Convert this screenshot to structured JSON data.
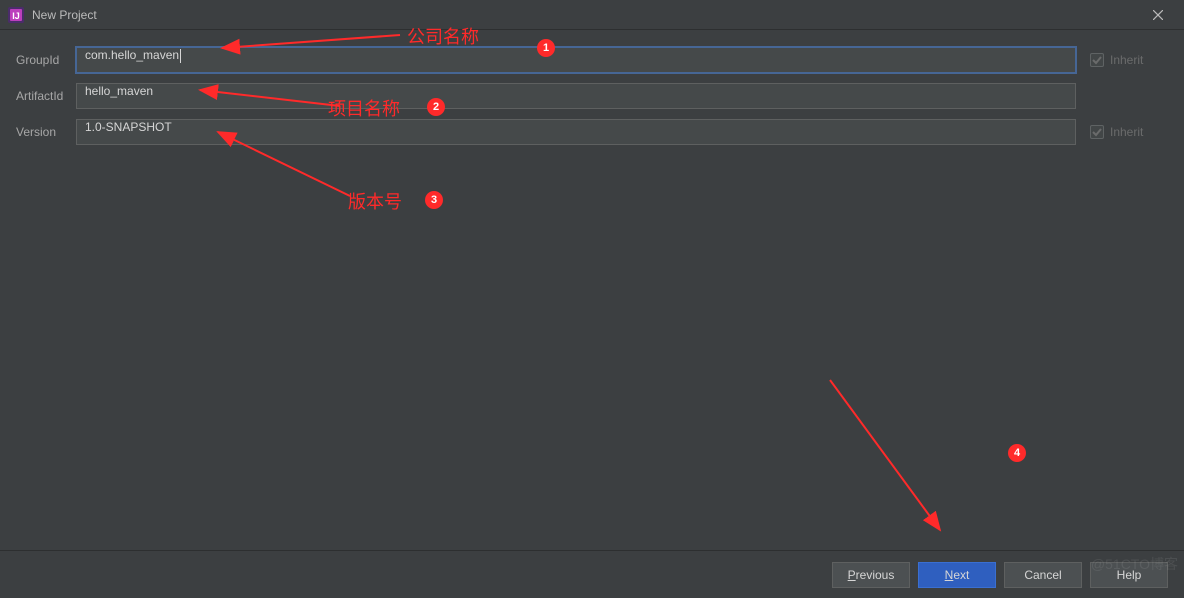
{
  "titlebar": {
    "title": "New Project"
  },
  "form": {
    "groupId": {
      "label": "GroupId",
      "value": "com.hello_maven",
      "inheritLabel": "Inherit",
      "inheritChecked": true,
      "focused": true
    },
    "artifactId": {
      "label": "ArtifactId",
      "value": "hello_maven"
    },
    "version": {
      "label": "Version",
      "value": "1.0-SNAPSHOT",
      "inheritLabel": "Inherit",
      "inheritChecked": true
    }
  },
  "footer": {
    "previousUL": "P",
    "previousRest": "revious",
    "nextUL": "N",
    "nextRest": "ext",
    "cancel": "Cancel",
    "help": "Help"
  },
  "annotations": [
    {
      "num": "1",
      "text": "公司名称"
    },
    {
      "num": "2",
      "text": "项目名称"
    },
    {
      "num": "3",
      "text": "版本号"
    },
    {
      "num": "4",
      "text": ""
    }
  ],
  "watermark": "@51CTO博客"
}
